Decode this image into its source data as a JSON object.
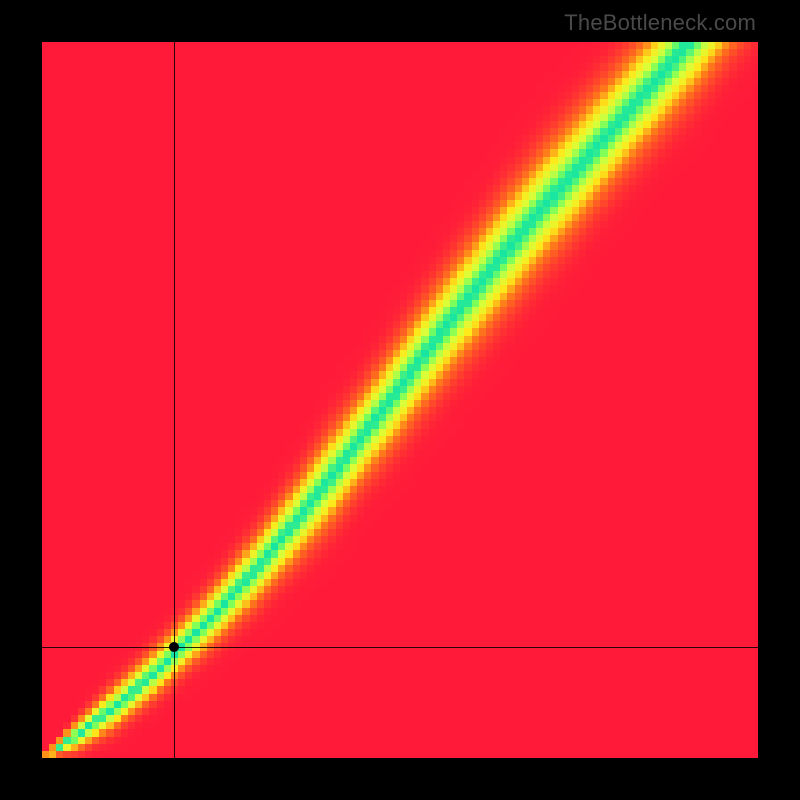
{
  "watermark": "TheBottleneck.com",
  "chart_data": {
    "type": "heatmap",
    "title": "",
    "xlabel": "",
    "ylabel": "",
    "xlim": [
      0,
      1
    ],
    "ylim": [
      0,
      1
    ],
    "grid": false,
    "legend": false,
    "crosshair": {
      "x": 0.185,
      "y": 0.155
    },
    "marker": {
      "x": 0.185,
      "y": 0.155,
      "color": "#000000"
    },
    "colormap": [
      {
        "t": 0.0,
        "color": "#ff1a3a"
      },
      {
        "t": 0.35,
        "color": "#ff7a1a"
      },
      {
        "t": 0.6,
        "color": "#ffe81a"
      },
      {
        "t": 0.8,
        "color": "#d8ff3a"
      },
      {
        "t": 0.92,
        "color": "#7dff5a"
      },
      {
        "t": 1.0,
        "color": "#18e6a0"
      }
    ],
    "band_lower": [
      {
        "x": 0.0,
        "y": 0.0
      },
      {
        "x": 0.05,
        "y": 0.015
      },
      {
        "x": 0.1,
        "y": 0.045
      },
      {
        "x": 0.15,
        "y": 0.085
      },
      {
        "x": 0.2,
        "y": 0.13
      },
      {
        "x": 0.25,
        "y": 0.175
      },
      {
        "x": 0.3,
        "y": 0.225
      },
      {
        "x": 0.35,
        "y": 0.28
      },
      {
        "x": 0.4,
        "y": 0.335
      },
      {
        "x": 0.45,
        "y": 0.4
      },
      {
        "x": 0.5,
        "y": 0.46
      },
      {
        "x": 0.55,
        "y": 0.525
      },
      {
        "x": 0.6,
        "y": 0.585
      },
      {
        "x": 0.65,
        "y": 0.645
      },
      {
        "x": 0.7,
        "y": 0.705
      },
      {
        "x": 0.75,
        "y": 0.76
      },
      {
        "x": 0.8,
        "y": 0.82
      },
      {
        "x": 0.85,
        "y": 0.875
      },
      {
        "x": 0.9,
        "y": 0.93
      },
      {
        "x": 0.95,
        "y": 0.99
      },
      {
        "x": 1.0,
        "y": 1.05
      }
    ],
    "band_upper": [
      {
        "x": 0.0,
        "y": 0.0
      },
      {
        "x": 0.05,
        "y": 0.05
      },
      {
        "x": 0.1,
        "y": 0.095
      },
      {
        "x": 0.15,
        "y": 0.14
      },
      {
        "x": 0.2,
        "y": 0.19
      },
      {
        "x": 0.25,
        "y": 0.245
      },
      {
        "x": 0.3,
        "y": 0.305
      },
      {
        "x": 0.35,
        "y": 0.37
      },
      {
        "x": 0.4,
        "y": 0.44
      },
      {
        "x": 0.45,
        "y": 0.505
      },
      {
        "x": 0.5,
        "y": 0.575
      },
      {
        "x": 0.55,
        "y": 0.645
      },
      {
        "x": 0.6,
        "y": 0.71
      },
      {
        "x": 0.65,
        "y": 0.775
      },
      {
        "x": 0.7,
        "y": 0.835
      },
      {
        "x": 0.75,
        "y": 0.89
      },
      {
        "x": 0.8,
        "y": 0.945
      },
      {
        "x": 0.85,
        "y": 1.0
      },
      {
        "x": 0.9,
        "y": 1.06
      },
      {
        "x": 0.95,
        "y": 1.12
      },
      {
        "x": 1.0,
        "y": 1.18
      }
    ],
    "band_center": [
      {
        "x": 0.0,
        "y": 0.0
      },
      {
        "x": 0.05,
        "y": 0.033
      },
      {
        "x": 0.1,
        "y": 0.07
      },
      {
        "x": 0.15,
        "y": 0.112
      },
      {
        "x": 0.2,
        "y": 0.16
      },
      {
        "x": 0.25,
        "y": 0.21
      },
      {
        "x": 0.3,
        "y": 0.265
      },
      {
        "x": 0.35,
        "y": 0.325
      },
      {
        "x": 0.4,
        "y": 0.388
      },
      {
        "x": 0.45,
        "y": 0.453
      },
      {
        "x": 0.5,
        "y": 0.518
      },
      {
        "x": 0.55,
        "y": 0.585
      },
      {
        "x": 0.6,
        "y": 0.648
      },
      {
        "x": 0.65,
        "y": 0.71
      },
      {
        "x": 0.7,
        "y": 0.77
      },
      {
        "x": 0.75,
        "y": 0.825
      },
      {
        "x": 0.8,
        "y": 0.882
      },
      {
        "x": 0.85,
        "y": 0.938
      },
      {
        "x": 0.9,
        "y": 0.995
      },
      {
        "x": 0.95,
        "y": 1.055
      },
      {
        "x": 1.0,
        "y": 1.115
      }
    ],
    "resolution": 100
  }
}
